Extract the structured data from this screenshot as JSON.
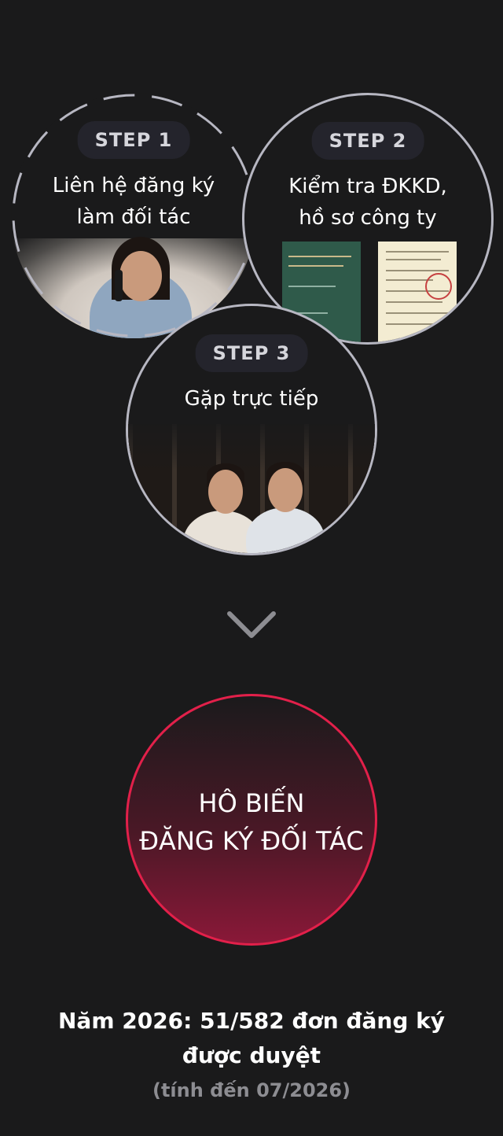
{
  "steps": [
    {
      "badge": "STEP 1",
      "title_line1": "Liên hệ đăng ký",
      "title_line2": "làm đối tác"
    },
    {
      "badge": "STEP 2",
      "title_line1": "Kiểm tra ĐKKD,",
      "title_line2": "hồ sơ công ty"
    },
    {
      "badge": "STEP 3",
      "title_line1": "Gặp trực tiếp"
    }
  ],
  "cta": {
    "line1": "HÔ BIẾN",
    "line2": "ĐĂNG KÝ ĐỐI TÁC"
  },
  "summary": {
    "line1": "Năm 2026: 51/582 đơn đăng ký",
    "line2": "được duyệt",
    "note": "(tính đến 07/2026)"
  },
  "icons": {
    "chevron": "chevron-down-icon"
  },
  "colors": {
    "background": "#1a1a1b",
    "accent": "#e2204a",
    "ring": "#b7b7c2",
    "badge_bg": "#24242c"
  }
}
